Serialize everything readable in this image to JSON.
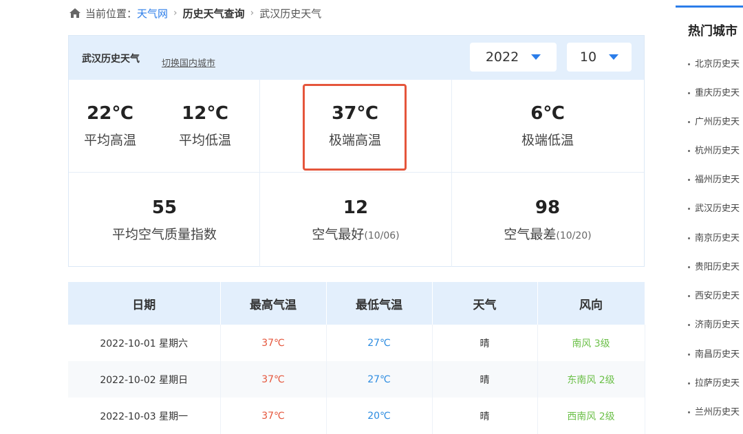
{
  "breadcrumb": {
    "prefix": "当前位置：",
    "site": "天气网",
    "section": "历史天气查询",
    "current": "武汉历史天气"
  },
  "summary": {
    "title": "武汉历史天气",
    "switch_link": "切换国内城市",
    "year": "2022",
    "month": "10",
    "avg_high": {
      "value": "22℃",
      "label": "平均高温"
    },
    "avg_low": {
      "value": "12℃",
      "label": "平均低温"
    },
    "extreme_high": {
      "value": "37℃",
      "label": "极端高温"
    },
    "extreme_low": {
      "value": "6℃",
      "label": "极端低温"
    },
    "avg_aqi": {
      "value": "55",
      "label": "平均空气质量指数"
    },
    "best_air": {
      "value": "12",
      "label": "空气最好",
      "date": "(10/06)"
    },
    "worst_air": {
      "value": "98",
      "label": "空气最差",
      "date": "(10/20)"
    }
  },
  "table": {
    "headers": [
      "日期",
      "最高气温",
      "最低气温",
      "天气",
      "风向"
    ],
    "rows": [
      {
        "date": "2022-10-01 星期六",
        "high": "37℃",
        "low": "27℃",
        "weather": "晴",
        "wind": "南风 3级"
      },
      {
        "date": "2022-10-02 星期日",
        "high": "37℃",
        "low": "27℃",
        "weather": "晴",
        "wind": "东南风 2级"
      },
      {
        "date": "2022-10-03 星期一",
        "high": "37℃",
        "low": "20℃",
        "weather": "晴",
        "wind": "西南风 2级"
      }
    ]
  },
  "sidebar": {
    "title": "热门城市",
    "items": [
      "北京历史天",
      "重庆历史天",
      "广州历史天",
      "杭州历史天",
      "福州历史天",
      "武汉历史天",
      "南京历史天",
      "贵阳历史天",
      "西安历史天",
      "济南历史天",
      "南昌历史天",
      "拉萨历史天",
      "兰州历史天"
    ]
  },
  "colors": {
    "accent": "#2b7de9",
    "header_bg": "#e3effc",
    "high_temp": "#e5553b",
    "low_temp": "#2b8be0",
    "wind": "#6cc049",
    "highlight": "#e5553b"
  }
}
